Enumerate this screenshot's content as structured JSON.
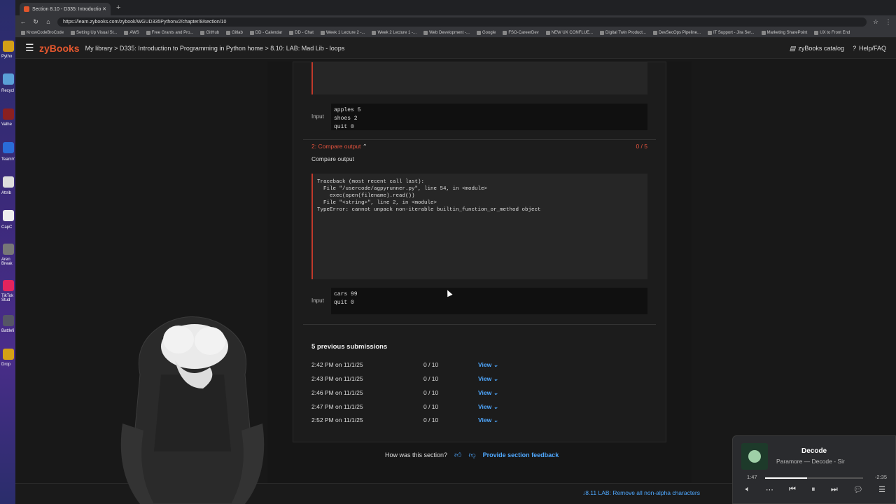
{
  "browser": {
    "tab_title": "Section 8.10 - D335: Introductio",
    "url": "https://learn.zybooks.com/zybook/WGUD335Pythonv2/chapter/8/section/10",
    "bookmarks": [
      "KnowCodeBroCode",
      "Setting Up Visual St...",
      "AWS",
      "Free Grants and Pro...",
      "GitHub",
      "Gitlab",
      "DD - Calendar",
      "DD - Chat",
      "Week 1 Lecture 2 -...",
      "Week 2 Lecture 1 -...",
      "Web Development -...",
      "Google",
      "FSO-CareerDev",
      "NEW UX CONFLUE...",
      "Digital Twin Product...",
      "DevSecOps Pipeline...",
      "IT Support - Jira Ser...",
      "Marketing SharePoint",
      "UX to Front End"
    ]
  },
  "header": {
    "logo": "zyBooks",
    "breadcrumb": "My library  >  D335: Introduction to Programming in Python home  >  8.10: LAB: Mad Lib - loops",
    "catalog": "zyBooks catalog",
    "help": "Help/FAQ"
  },
  "test1": {
    "input_label": "Input",
    "input": "apples 5\nshoes 2\nquit 0"
  },
  "test2": {
    "title": "2: Compare output",
    "score": "0 / 5",
    "subtitle": "Compare output",
    "traceback": "Traceback (most recent call last):\n  File \"/usercode/agpyrunner.py\", line 54, in <module>\n    exec(open(filename).read())\n  File \"<string>\", line 2, in <module>\nTypeError: cannot unpack non-iterable builtin_function_or_method object",
    "input_label": "Input",
    "input": "cars 99\nquit 0"
  },
  "submissions": {
    "title": "5 previous submissions",
    "view_label": "View",
    "rows": [
      {
        "time": "2:42 PM on 11/1/25",
        "score": "0 / 10"
      },
      {
        "time": "2:43 PM on 11/1/25",
        "score": "0 / 10"
      },
      {
        "time": "2:46 PM on 11/1/25",
        "score": "0 / 10"
      },
      {
        "time": "2:47 PM on 11/1/25",
        "score": "0 / 10"
      },
      {
        "time": "2:52 PM on 11/1/25",
        "score": "0 / 10"
      }
    ]
  },
  "feedback": {
    "question": "How was this section?",
    "link": "Provide section feedback"
  },
  "next_section": "↓8.11 LAB: Remove all non-alpha characters",
  "media": {
    "title": "Decode",
    "artist": "Paramore — Decode - Sir",
    "elapsed": "1:47",
    "remaining": "-2:35",
    "progress": 0.43
  },
  "desktop_labels": [
    "Pytho",
    "Recycl",
    "Valhe",
    "TeamV",
    "Attrib",
    "CapC",
    "Aren Break",
    "TikTok Stud",
    "Battlefi",
    "Drop"
  ]
}
